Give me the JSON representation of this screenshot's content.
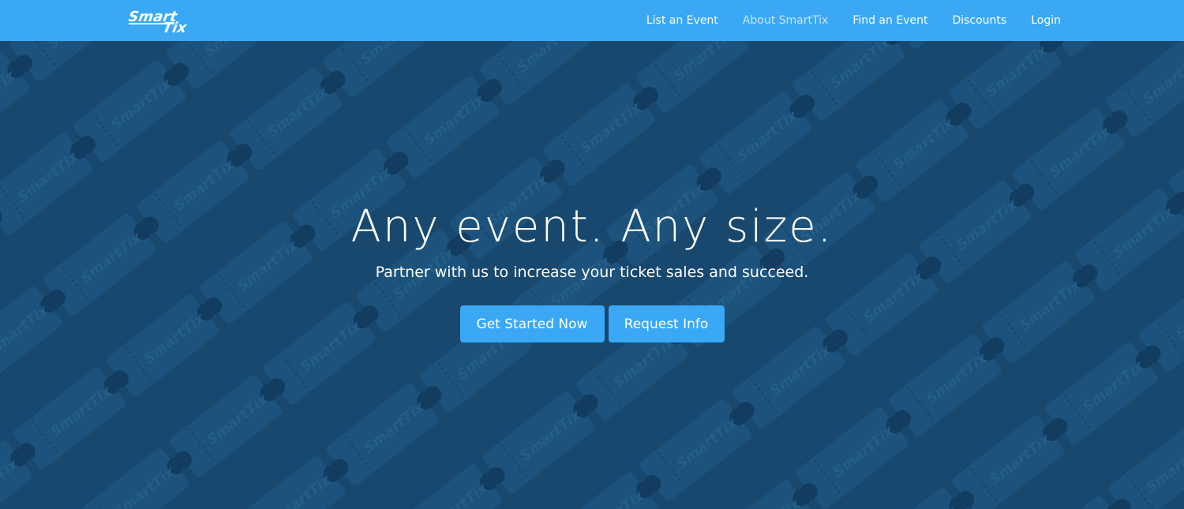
{
  "brand": {
    "logo_text_top": "Smart",
    "logo_text_bottom": "Tix",
    "bar_color": "#3aa8f4"
  },
  "nav": {
    "items": [
      {
        "label": "List an Event",
        "active": false
      },
      {
        "label": "About SmartTix",
        "active": true
      },
      {
        "label": "Find an Event",
        "active": false
      },
      {
        "label": "Discounts",
        "active": false
      },
      {
        "label": "Login",
        "active": false
      }
    ]
  },
  "hero": {
    "headline": "Any event. Any size.",
    "subheadline": "Partner with us to increase your ticket sales and succeed.",
    "background_color": "#1a4d74",
    "pattern_text": "SmartTix",
    "buttons": {
      "primary_label": "Get Started Now",
      "secondary_label": "Request Info"
    }
  }
}
